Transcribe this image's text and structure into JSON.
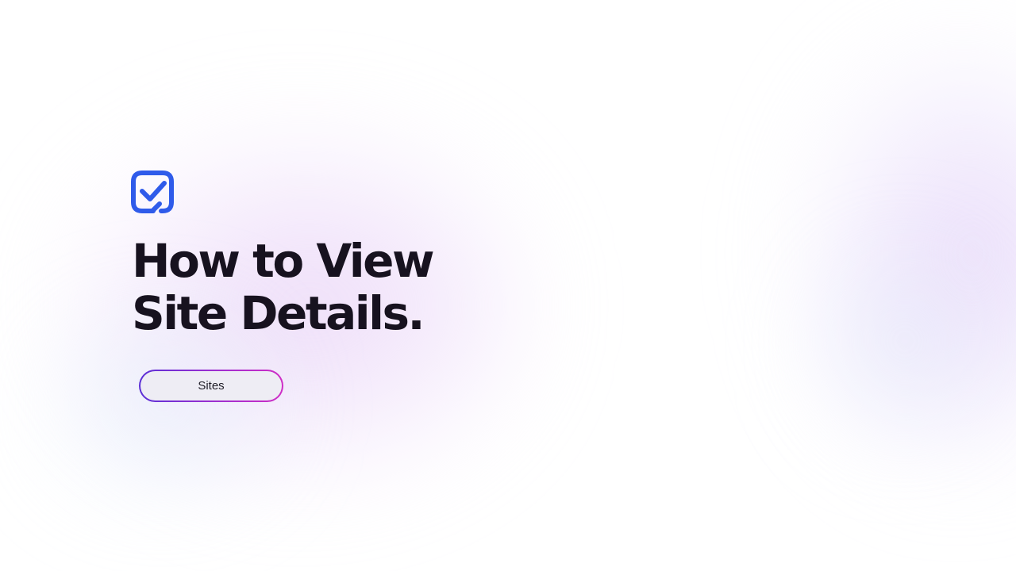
{
  "logo": {
    "icon": "checkbox-check-icon",
    "color": "#2f5bea"
  },
  "heading": {
    "line1": "How to View",
    "line2": "Site Details."
  },
  "tag": {
    "label": "Sites"
  },
  "colors": {
    "title": "#17121f",
    "pill_border_start": "#5a2fd6",
    "pill_border_end": "#cf2ec6"
  }
}
